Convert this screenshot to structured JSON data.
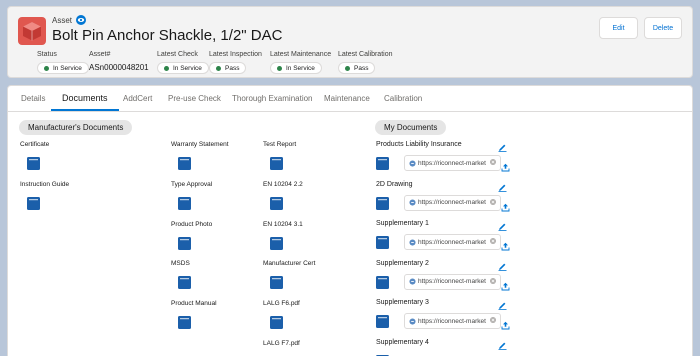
{
  "header": {
    "object_kind": "Asset",
    "title": "Bolt Pin Anchor Shackle, 1/2\" DAC",
    "edit_label": "Edit",
    "delete_label": "Delete",
    "fields": [
      {
        "label": "Status",
        "value": "In Service",
        "badge": true
      },
      {
        "label": "Asset#",
        "value": "ASn0000048201",
        "badge": false
      },
      {
        "label": "Latest Check",
        "value": "In Service",
        "badge": true
      },
      {
        "label": "Latest Inspection",
        "value": "Pass",
        "badge": true
      },
      {
        "label": "Latest Maintenance",
        "value": "In Service",
        "badge": true
      },
      {
        "label": "Latest Calibration",
        "value": "Pass",
        "badge": true
      }
    ]
  },
  "tabs": [
    "Details",
    "Documents",
    "AddCert",
    "Pre-use Check",
    "Thorough Examination",
    "Maintenance",
    "Calibration"
  ],
  "active_tab": "Documents",
  "manufacturer_docs": {
    "heading": "Manufacturer's Documents",
    "items": [
      "Certificate",
      "Instruction Guide",
      "Warranty Statement",
      "Type Approval",
      "Product Photo",
      "MSDS",
      "Product Manual",
      "Test Report",
      "EN 10204 2.2",
      "EN 10204 3.1",
      "Manufacturer Cert",
      "LALG F6.pdf",
      "LALG F7.pdf"
    ]
  },
  "my_docs": {
    "heading": "My Documents",
    "items": [
      {
        "label": "Products Liability Insurance",
        "url": "https://riconnect-market"
      },
      {
        "label": "2D Drawing",
        "url": "https://riconnect-market"
      },
      {
        "label": "Supplementary 1",
        "url": "https://riconnect-market"
      },
      {
        "label": "Supplementary 2",
        "url": "https://riconnect-market"
      },
      {
        "label": "Supplementary 3",
        "url": "https://riconnect-market"
      },
      {
        "label": "Supplementary 4",
        "url": ""
      }
    ]
  },
  "colors": {
    "accent": "#0176d3",
    "folder": "#1b5faa",
    "status_dot": "#2e844a",
    "asset_icon": "#e0574f"
  },
  "icons": {
    "asset": "cube-icon",
    "follow": "eye-icon",
    "folder": "folder-icon",
    "edit": "pencil-icon",
    "upload": "upload-icon",
    "link": "link-icon",
    "clear": "clear-icon"
  }
}
